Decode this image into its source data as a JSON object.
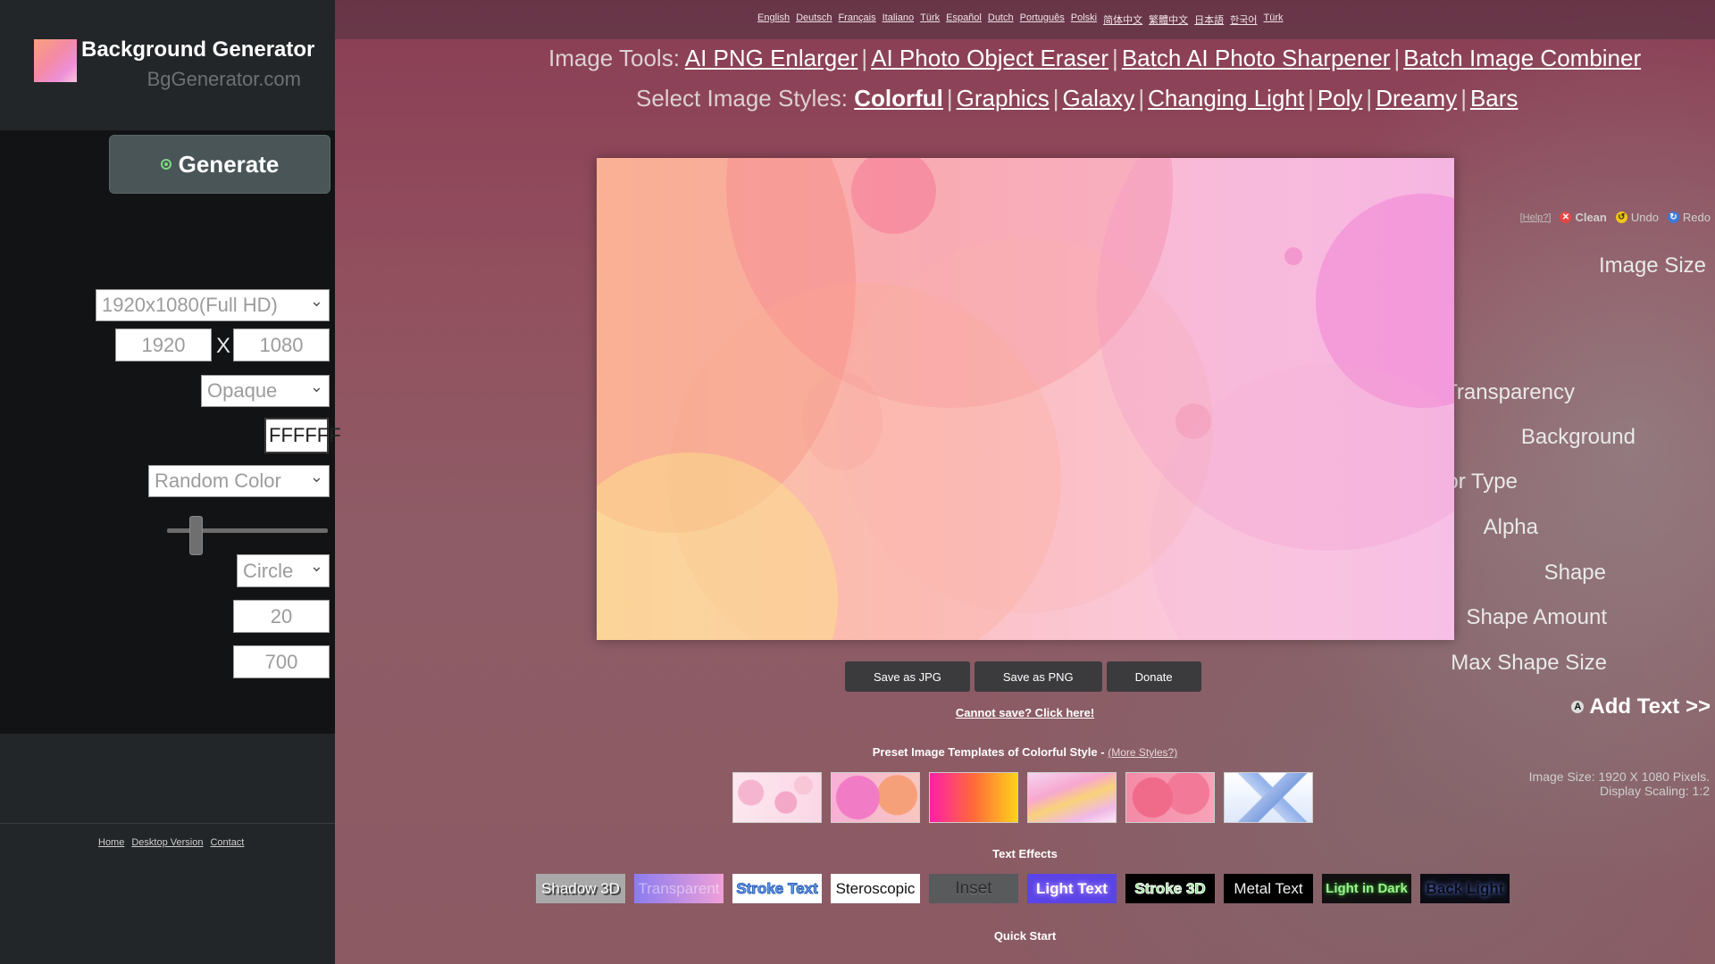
{
  "brand": {
    "title": "Background Generator",
    "subtitle": "BgGenerator.com"
  },
  "sidebar": {
    "generate_label": "Generate",
    "help_label": "[Help?]",
    "clean_label": "Clean",
    "undo_label": "Undo",
    "redo_label": "Redo",
    "image_size_label": "Image Size",
    "image_size_selected": "1920x1080(Full HD)",
    "width_value": "1920",
    "x_label": "X",
    "height_value": "1080",
    "transparency_label": "Transparency",
    "transparency_selected": "Opaque",
    "background_label": "Background",
    "background_value": "FFFFFF",
    "color_type_label": "Color Type",
    "color_type_selected": "Random Color",
    "alpha_label": "Alpha",
    "alpha_value": 0.15,
    "shape_label": "Shape",
    "shape_selected": "Circle",
    "shape_amount_label": "Shape Amount",
    "shape_amount_value": "20",
    "max_shape_size_label": "Max Shape Size",
    "max_shape_size_value": "700",
    "add_text_label": "Add Text >>",
    "info_size": "Image Size: 1920 X 1080 Pixels.",
    "info_scaling": "Display Scaling: 1:2",
    "footer": {
      "home": "Home",
      "desktop": "Desktop Version",
      "contact": "Contact"
    }
  },
  "languages": [
    "English",
    "Deutsch",
    "Français",
    "Italiano",
    "Türk",
    "Español",
    "Dutch",
    "Português",
    "Polski",
    "简体中文",
    "繁體中文",
    "日本語",
    "한국어",
    "Türk"
  ],
  "tools": {
    "prefix": "Image Tools:",
    "links": [
      "AI PNG Enlarger",
      "AI Photo Object Eraser",
      "Batch AI Photo Sharpener",
      "Batch Image Combiner"
    ]
  },
  "styles": {
    "prefix": "Select Image Styles:",
    "links": [
      "Colorful",
      "Graphics",
      "Galaxy",
      "Changing Light",
      "Poly",
      "Dreamy",
      "Bars"
    ]
  },
  "buttons": {
    "save_jpg": "Save as JPG",
    "save_png": "Save as PNG",
    "donate": "Donate"
  },
  "cannot_save": "Cannot save? Click here!",
  "presets": {
    "title": "Preset Image Templates of Colorful Style",
    "dash": " - ",
    "more": "(More Styles?)"
  },
  "text_effects": {
    "title": "Text Effects",
    "items": [
      "Shadow 3D",
      "Transparent",
      "Stroke Text",
      "Steroscopic",
      "Inset",
      "Light Text",
      "Stroke 3D",
      "Metal Text",
      "Light in Dark",
      "Back Light"
    ]
  },
  "quick_start": "Quick Start",
  "colors": {
    "sidebar": "#121314",
    "brand_bg": "#232628",
    "generate_btn": "#4a5557",
    "page_bg": "#8a3d55"
  }
}
